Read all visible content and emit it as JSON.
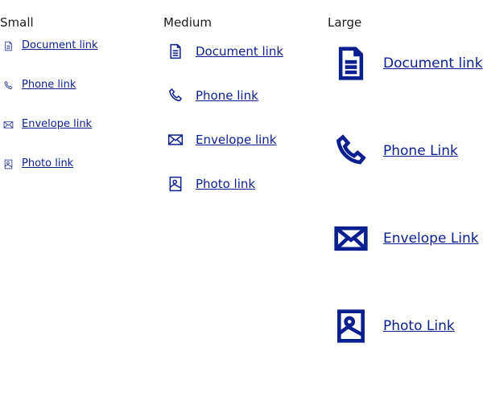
{
  "accent_color": "#0a1f8f",
  "columns": {
    "small": {
      "heading": "Small",
      "links": [
        {
          "label": "Document link",
          "icon": "document-icon"
        },
        {
          "label": "Phone link",
          "icon": "phone-icon"
        },
        {
          "label": "Envelope link",
          "icon": "envelope-icon"
        },
        {
          "label": "Photo link",
          "icon": "photo-icon"
        }
      ]
    },
    "medium": {
      "heading": "Medium",
      "links": [
        {
          "label": "Document link",
          "icon": "document-icon"
        },
        {
          "label": "Phone link",
          "icon": "phone-icon"
        },
        {
          "label": "Envelope link",
          "icon": "envelope-icon"
        },
        {
          "label": "Photo link",
          "icon": "photo-icon"
        }
      ]
    },
    "large": {
      "heading": "Large",
      "links": [
        {
          "label": "Document link",
          "icon": "document-icon"
        },
        {
          "label": "Phone Link",
          "icon": "phone-icon"
        },
        {
          "label": "Envelope Link",
          "icon": "envelope-icon"
        },
        {
          "label": "Photo Link",
          "icon": "photo-icon"
        }
      ]
    }
  }
}
